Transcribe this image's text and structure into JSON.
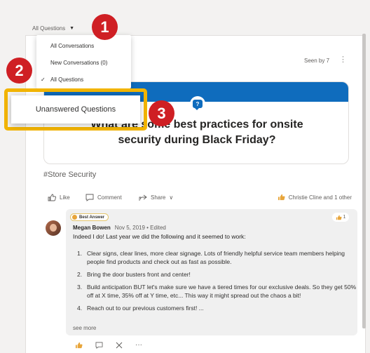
{
  "filter": {
    "label": "All Questions",
    "caret": "▼"
  },
  "menu": {
    "items": [
      {
        "label": "All Conversations"
      },
      {
        "label": "New Conversations (0)"
      },
      {
        "label": "All Questions",
        "checked": true
      },
      {
        "label": "Unanswered Questions"
      }
    ]
  },
  "callouts": [
    "1",
    "2",
    "3"
  ],
  "post": {
    "seen_by": "Seen by 7",
    "more": "⋮",
    "question_icon": "question-bubble-icon",
    "title": "What are some best practices for onsite security during Black Friday?",
    "tag": "#Store Security",
    "actions": {
      "like": "Like",
      "comment": "Comment",
      "share": "Share",
      "share_caret": "∨"
    },
    "reacted_by": "Christie Cline and 1 other"
  },
  "answer": {
    "badge": "Best Answer",
    "like_count": "1",
    "author": "Megan Bowen",
    "meta": "Nov 5, 2019  •  Edited",
    "lead": "Indeed I do! Last year we did the following and it seemed to work:",
    "items": [
      "Clear signs, clear lines, more clear signage. Lots of friendly helpful service team members helping people find products and check out as fast as possible.",
      "Bring the door busters front and center!",
      "Build anticipation BUT let's make sure we have a tiered times for our exclusive deals. So they get 50% off at X time, 35% off at Y time, etc...  This way it might spread out the chaos a bit!",
      "Reach out to our previous customers first! ..."
    ],
    "see_more": "see more",
    "more": "···"
  },
  "colors": {
    "accent": "#0f6cbd",
    "highlight": "#f2b400",
    "callout": "#cf1f24",
    "like": "#e8a53a"
  }
}
